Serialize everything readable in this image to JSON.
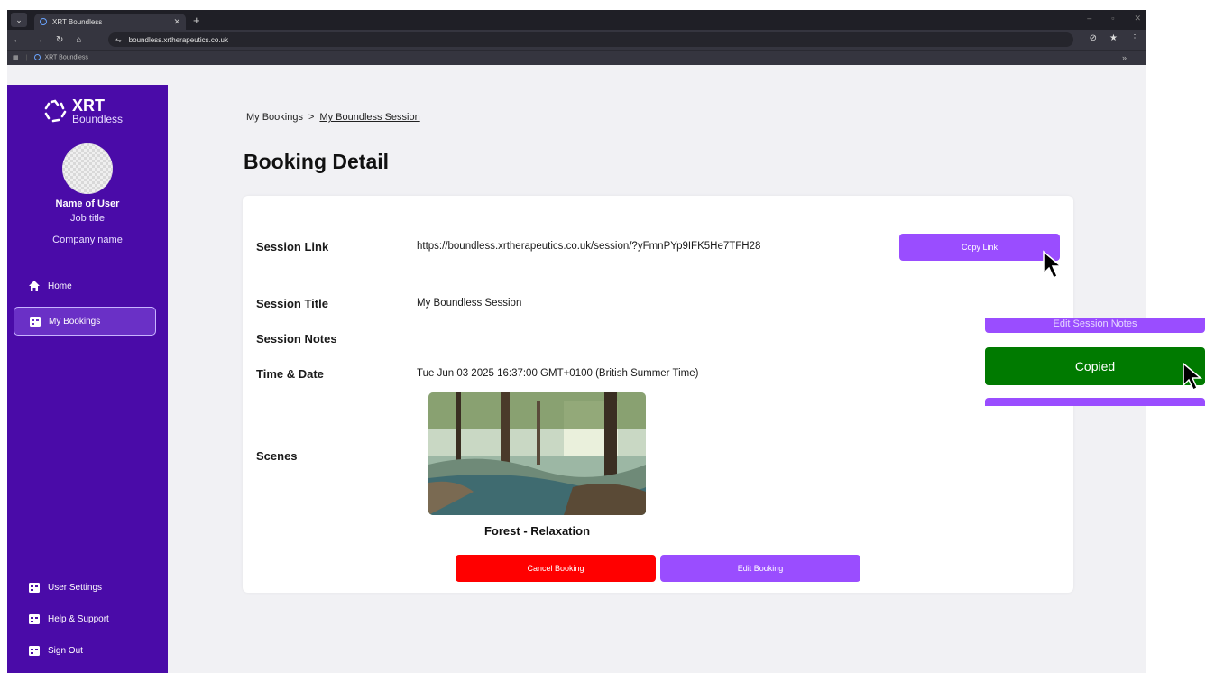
{
  "browser": {
    "tab_title": "XRT Boundless",
    "url": "boundless.xrtherapeutics.co.uk",
    "bookmark_label": "XRT Boundless",
    "icons": [
      "menu-icon",
      "close-icon",
      "new-tab-icon",
      "back-icon",
      "forward-icon",
      "reload-icon",
      "home-icon",
      "site-settings-icon",
      "eye-off-icon",
      "star-icon",
      "more-icon",
      "apps-icon"
    ]
  },
  "sidebar": {
    "logo_line1": "XRT",
    "logo_line2": "Boundless",
    "user_name": "Name of User",
    "job_title": "Job title",
    "company": "Company name",
    "nav": {
      "home": "Home",
      "my_bookings": "My Bookings",
      "user_settings": "User Settings",
      "help": "Help & Support",
      "sign_out": "Sign Out"
    }
  },
  "main": {
    "breadcrumb_root": "My Bookings",
    "breadcrumb_sep": ">",
    "breadcrumb_current": "My Boundless Session",
    "title": "Booking Detail"
  },
  "booking": {
    "session_link_label": "Session Link",
    "session_link": "https://boundless.xrtherapeutics.co.uk/session/?yFmnPYp9IFK5He7TFH28",
    "copy_link": "Copy Link",
    "session_title_label": "Session Title",
    "session_title": "My Boundless Session",
    "session_notes_label": "Session Notes",
    "time_date_label": "Time & Date",
    "time_date": "Tue Jun 03 2025 16:37:00 GMT+0100 (British Summer Time)",
    "scenes_label": "Scenes",
    "scene_name": "Forest - Relaxation",
    "cancel_booking": "Cancel Booking",
    "edit_booking": "Edit Booking"
  },
  "callout": {
    "copied": "Copied",
    "top_bar_text": "Edit Session Notes"
  },
  "colors": {
    "sidebar": "#4a0ba8",
    "accent": "#9a4dff",
    "danger": "#ff0000",
    "success": "#007a00"
  }
}
